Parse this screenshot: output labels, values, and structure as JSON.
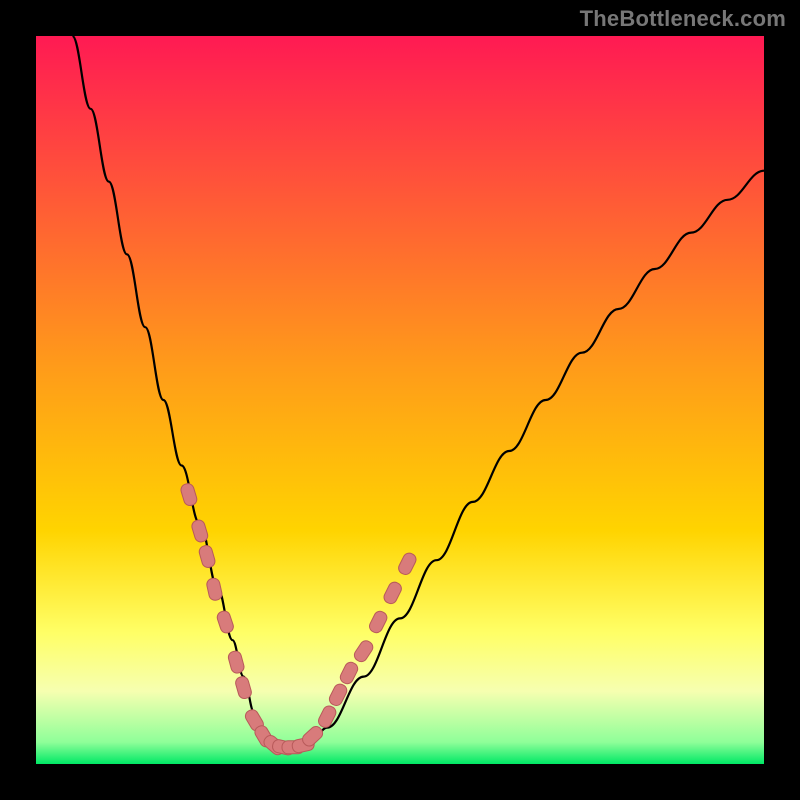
{
  "watermark": "TheBottleneck.com",
  "colors": {
    "bg": "#000000",
    "grad_top": "#ff1a53",
    "grad_mid": "#ffd400",
    "grad_low": "#ffff66",
    "grad_bottom": "#00e865",
    "curve": "#000000",
    "bead_fill": "#d87b7b",
    "bead_stroke": "#b85a5a"
  },
  "chart_data": {
    "type": "line",
    "title": "",
    "xlabel": "",
    "ylabel": "",
    "xlim": [
      0,
      100
    ],
    "ylim": [
      0,
      100
    ],
    "series": [
      {
        "name": "bottleneck-curve",
        "x": [
          5,
          7.5,
          10,
          12.5,
          15,
          17.5,
          20,
          22.5,
          25,
          27,
          28.5,
          30,
          31.5,
          33,
          35,
          37.5,
          40,
          45,
          50,
          55,
          60,
          65,
          70,
          75,
          80,
          85,
          90,
          95,
          100
        ],
        "y": [
          100,
          90,
          80,
          70,
          60,
          50,
          41,
          33,
          24,
          17,
          12,
          7,
          4,
          2.5,
          2.2,
          2.5,
          5,
          12,
          20,
          28,
          36,
          43,
          50,
          56.5,
          62.5,
          68,
          73,
          77.5,
          81.5
        ]
      }
    ],
    "beads": {
      "name": "highlighted-points",
      "left_branch": [
        [
          21,
          37
        ],
        [
          22.5,
          32
        ],
        [
          23.5,
          28.5
        ],
        [
          24.5,
          24
        ],
        [
          26,
          19.5
        ],
        [
          27.5,
          14
        ],
        [
          28.5,
          10.5
        ]
      ],
      "bottom": [
        [
          30,
          6
        ],
        [
          31.3,
          3.8
        ],
        [
          32.7,
          2.6
        ],
        [
          34,
          2.3
        ],
        [
          35.3,
          2.3
        ],
        [
          36.7,
          2.6
        ],
        [
          38,
          3.8
        ]
      ],
      "right_branch": [
        [
          40,
          6.5
        ],
        [
          41.5,
          9.5
        ],
        [
          43,
          12.5
        ],
        [
          45,
          15.5
        ],
        [
          47,
          19.5
        ],
        [
          49,
          23.5
        ],
        [
          51,
          27.5
        ]
      ]
    }
  }
}
